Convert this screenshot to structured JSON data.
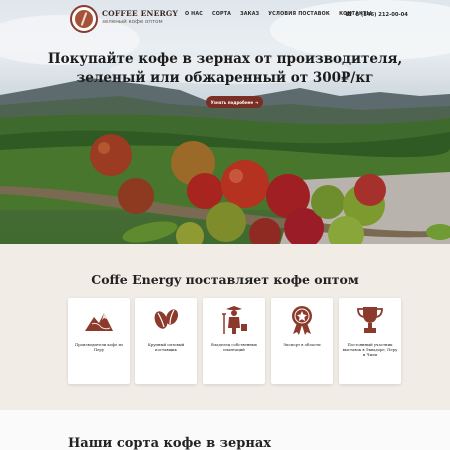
{
  "header": {
    "brand_name": "COFFEE ENERGY",
    "brand_sub": "зеленый кофе оптом",
    "nav": [
      "О НАС",
      "СОРТА",
      "ЗАКАЗ",
      "УСЛОВИЯ ПОСТАВОК",
      "КОНТАКТЫ"
    ],
    "phone": "8 (846) 212-00-04"
  },
  "hero": {
    "title_line1": "Покупайте кофе в зернах от производителя,",
    "title_line2": "зеленый или обжаренный от 300₽/кг",
    "button_label": "Узнать подробнее"
  },
  "features": {
    "title": "Coffe Energy поставляет кофе оптом",
    "cards": [
      {
        "text": "Производители кофе из Перу",
        "icon": "mountain-icon"
      },
      {
        "text": "Крупный оптовый поставщик",
        "icon": "coffee-beans-icon"
      },
      {
        "text": "Владелец собственных плантаций",
        "icon": "farmer-icon"
      },
      {
        "text": "Экспорт в области",
        "icon": "award-icon"
      },
      {
        "text": "Постоянный участник выставок в Эквадоре, Перу и Чили",
        "icon": "trophy-icon"
      }
    ]
  },
  "varieties": {
    "title": "Наши сорта кофе в зернах"
  },
  "colors": {
    "accent": "#7b2f24",
    "icon": "#8b3a2b",
    "background": "#f1ece6"
  }
}
